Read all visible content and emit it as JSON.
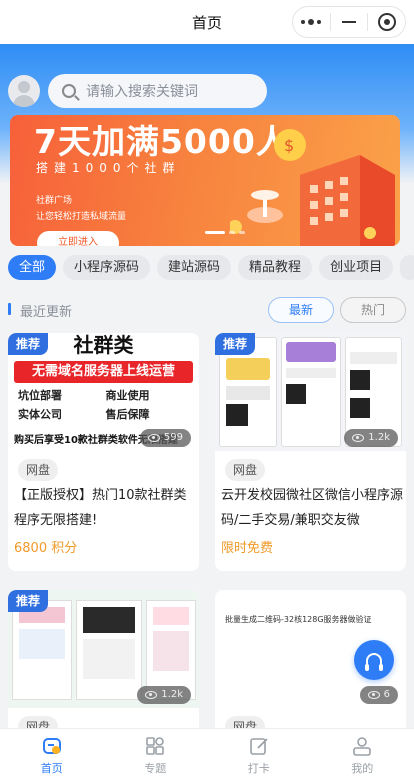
{
  "nav": {
    "title": "首页"
  },
  "search": {
    "placeholder": "请输入搜索关键词"
  },
  "banner": {
    "title": "7天加满5000人",
    "subtitle": "搭建1000个社群",
    "line1": "社群广场",
    "line2": "让您轻松打造私域流量",
    "button": "立即进入"
  },
  "categories": [
    {
      "label": "全部",
      "active": true
    },
    {
      "label": "小程序源码"
    },
    {
      "label": "建站源码"
    },
    {
      "label": "精品教程"
    },
    {
      "label": "创业项目"
    }
  ],
  "section": {
    "title": "最近更新",
    "tab_new": "最新",
    "tab_hot": "热门"
  },
  "cards": [
    {
      "badge": "推荐",
      "views": "599",
      "tag": "网盘",
      "title": "【正版授权】热门10款社群类程序无限搭建!",
      "price": "6800 积分",
      "img_heading": "社群类",
      "img_banner": "无需域名服务器上线运营",
      "img_checks": [
        "坑位部署",
        "商业使用",
        "实体公司",
        "售后保障"
      ],
      "img_footer": "购买后享受10款社群类软件无限搭建"
    },
    {
      "badge": "推荐",
      "views": "1.2k",
      "tag": "网盘",
      "title": "云开发校园微社区微信小程序源码/二手交易/兼职交友微",
      "price": "限时免费"
    },
    {
      "badge": "推荐",
      "views": "1.2k",
      "tag": "网盘"
    },
    {
      "views": "6",
      "tag": "网盘",
      "img_heading": "批量生成二维码-32核128G服务器做验证"
    }
  ],
  "tabbar": [
    {
      "label": "首页",
      "icon": "home-icon",
      "active": true
    },
    {
      "label": "专题",
      "icon": "grid-icon"
    },
    {
      "label": "打卡",
      "icon": "edit-icon"
    },
    {
      "label": "我的",
      "icon": "user-icon"
    }
  ],
  "colors": {
    "primary": "#2f7df6",
    "price": "#f09a28",
    "banner": "#f7603a"
  }
}
